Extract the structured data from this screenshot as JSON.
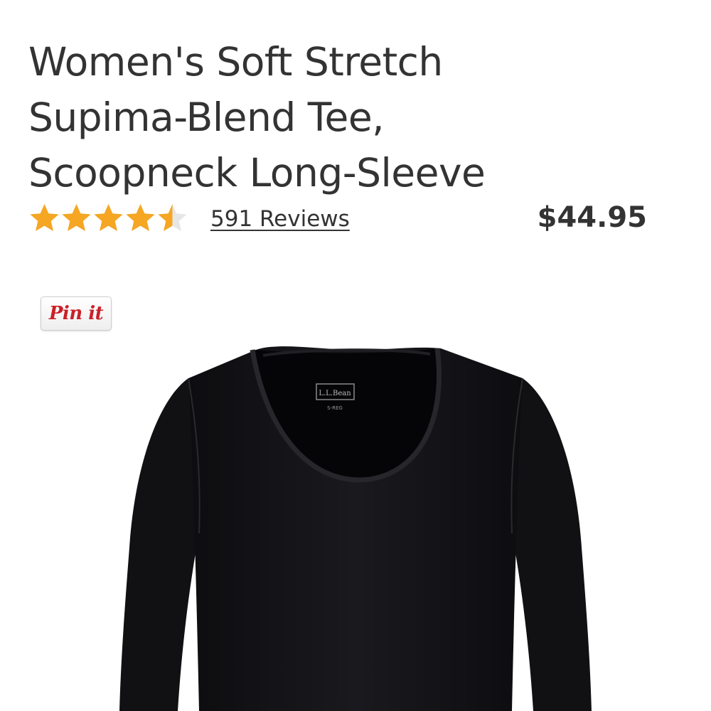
{
  "product": {
    "title_lines": [
      "Women's Soft Stretch",
      "Supima-Blend Tee,",
      "Scoopneck Long-Sleeve"
    ],
    "rating": 4.5,
    "rating_max": 5,
    "reviews_label": "591 Reviews",
    "price": "$44.95",
    "image": {
      "label_brand": "L.L.Bean",
      "label_size": "S-REG"
    }
  },
  "share": {
    "pin_label": "Pin it"
  },
  "colors": {
    "star_fill": "#f5a623",
    "star_empty": "#e6e6e6",
    "text": "#333333",
    "pin_red": "#cb2027",
    "garment": "#151518"
  },
  "icons": {
    "star": "star-icon",
    "pin": "pinterest-pin-it-icon"
  }
}
